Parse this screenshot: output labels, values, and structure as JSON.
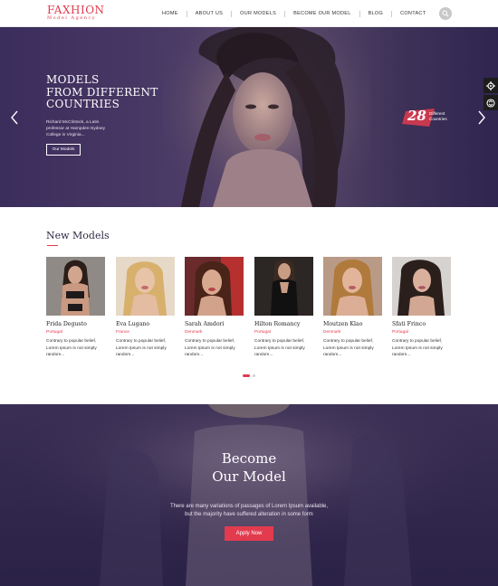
{
  "brand": {
    "name": "FAXHION",
    "tagline": "Model Agency",
    "accent": "#e23b4e"
  },
  "nav": {
    "items": [
      "HOME",
      "ABOUT US",
      "OUR MODELS",
      "BECOME OUR MODEL",
      "BLOG",
      "CONTACT"
    ],
    "search_icon": "search-icon"
  },
  "hero": {
    "title_lines": [
      "MODELS",
      "FROM DIFFERENT",
      "COUNTRIES"
    ],
    "text_lines": [
      "Richard McClintock, a Latin",
      "professor at Hampden-Sydney",
      "College in Virginia..."
    ],
    "button": "Our Models",
    "badge": {
      "number": "28",
      "line1": "Different",
      "line2": "Countries"
    },
    "prev_icon": "chevron-left-icon",
    "next_icon": "chevron-right-icon",
    "side_tools": [
      "gear-icon",
      "switch-icon"
    ]
  },
  "new_models": {
    "title": "New Models",
    "models": [
      {
        "name": "Frida Degusto",
        "country": "Portugal",
        "desc": [
          "Contrary to popular belief,",
          "Lorem Ipsum is not simply",
          "random..."
        ]
      },
      {
        "name": "Eva Lugano",
        "country": "France",
        "desc": [
          "Contrary to popular belief,",
          "Lorem Ipsum is not simply",
          "random..."
        ]
      },
      {
        "name": "Sarah Amdori",
        "country": "Denmark",
        "desc": [
          "Contrary to popular belief,",
          "Lorem Ipsum is not simply",
          "random..."
        ]
      },
      {
        "name": "Hilton Romancy",
        "country": "Portugal",
        "desc": [
          "Contrary to popular belief,",
          "Lorem Ipsum is not simply",
          "random..."
        ]
      },
      {
        "name": "Moutzen Klao",
        "country": "Denmark",
        "desc": [
          "Contrary to popular belief,",
          "Lorem Ipsum is not simply",
          "random..."
        ]
      },
      {
        "name": "Sfati Frinco",
        "country": "Portugal",
        "desc": [
          "Contrary to popular belief,",
          "Lorem Ipsum is not simply",
          "random..."
        ]
      }
    ]
  },
  "become": {
    "title_lines": [
      "Become",
      "Our Model"
    ],
    "text_lines": [
      "There are many variations of passages of Lorem Ipsum available,",
      "but the majority have suffered alteration in some form"
    ],
    "button": "Apply Now"
  }
}
